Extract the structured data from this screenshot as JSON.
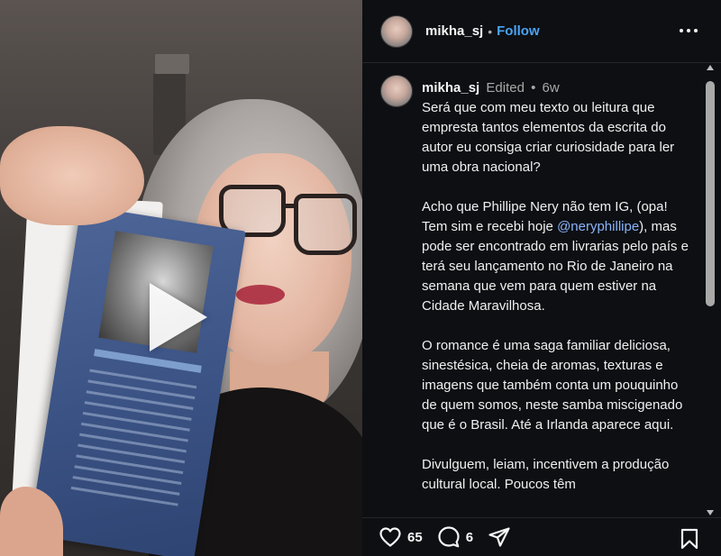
{
  "header": {
    "username": "mikha_sj",
    "separator": "•",
    "follow_label": "Follow"
  },
  "caption": {
    "username": "mikha_sj",
    "edited": "Edited",
    "separator": "•",
    "time": "6w",
    "p1": "Será que com meu texto ou leitura que empresta tantos elementos da escrita do autor eu consiga criar curiosidade para ler uma obra nacional?",
    "p2_start": "Acho que Phillipe Nery não tem IG, (opa! Tem sim e recebi hoje ",
    "p2_mention": "@neryphillipe",
    "p2_end": "), mas pode ser encontrado em livrarias pelo país e terá seu lançamento no Rio de Janeiro na semana que vem para quem estiver na Cidade Maravilhosa.",
    "p3": "O romance é uma saga familiar deliciosa, sinestésica, cheia de aromas, texturas e imagens que também conta um pouquinho de quem somos, neste samba miscigenado que é o Brasil. Até a Irlanda aparece aqui.",
    "p4": "Divulguem, leiam, incentivem a produção cultural local. Poucos têm"
  },
  "actions": {
    "likes": "65",
    "comments": "6"
  },
  "icons": {
    "like": "heart-icon",
    "comment": "comment-icon",
    "share": "share-icon",
    "save": "bookmark-icon",
    "more": "more-options-icon",
    "play": "play-icon"
  },
  "colors": {
    "accent_follow": "#4aa3f5",
    "mention": "#8ab4f8",
    "panel_bg": "#0d0f13"
  }
}
